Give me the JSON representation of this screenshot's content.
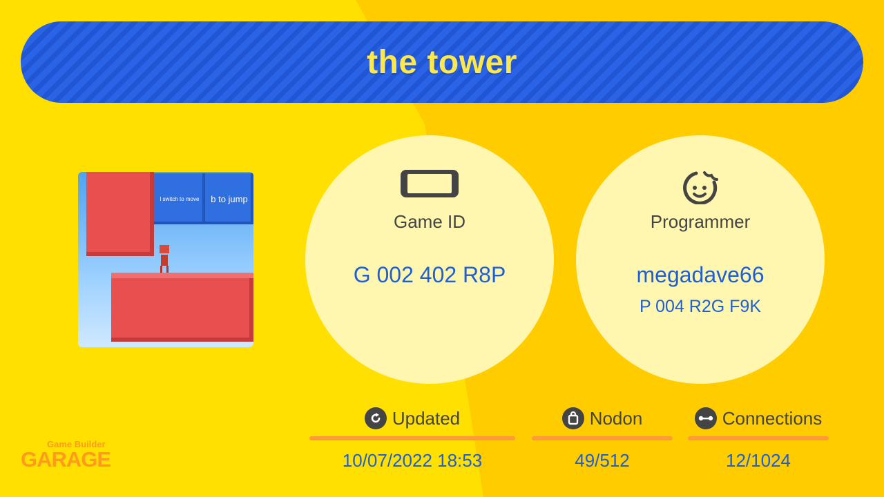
{
  "title": "the tower",
  "thumbnail": {
    "sign_left": "l switch to move",
    "sign_right": "b to jump"
  },
  "game_id": {
    "label": "Game ID",
    "value": "G 002 402 R8P",
    "icon": "switch-console-icon"
  },
  "programmer": {
    "label": "Programmer",
    "name": "megadave66",
    "id": "P 004 R2G F9K",
    "icon": "smiley-face-icon"
  },
  "stats": {
    "updated": {
      "label": "Updated",
      "value": "10/07/2022 18:53",
      "icon": "refresh-icon"
    },
    "nodon": {
      "label": "Nodon",
      "value": "49/512",
      "icon": "bag-icon"
    },
    "connections": {
      "label": "Connections",
      "value": "12/1024",
      "icon": "connection-icon"
    }
  },
  "logo": {
    "line1": "Game Builder",
    "line2": "GARAGE"
  },
  "colors": {
    "accent_blue": "#1e5fd6",
    "banner_blue": "#2b63e6",
    "title_yellow": "#ffe84a",
    "bar_orange": "#ff9a3a",
    "bg_yellow": "#ffe000"
  }
}
